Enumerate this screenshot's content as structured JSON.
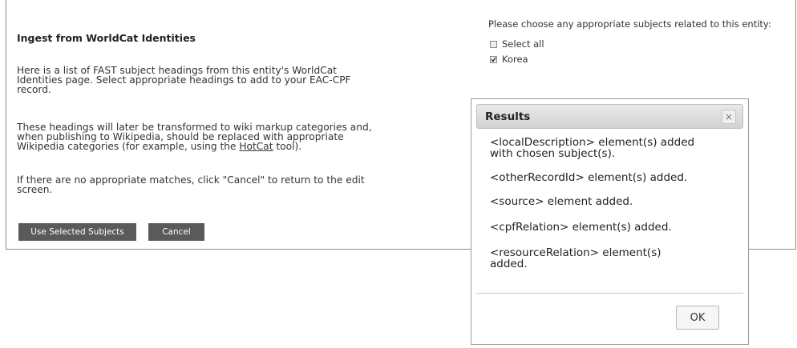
{
  "ingest": {
    "title": "Ingest from WorldCat Identities",
    "para1_line1": "Here is a list of FAST subject headings from this entity's WorldCat",
    "para1_line2": "Identities page. Select appropriate headings to add to your EAC-CPF",
    "para1_line3": "record.",
    "para2_line1": "These headings will later be transformed to wiki markup categories and,",
    "para2_line2": "when publishing to Wikipedia, should be replaced with appropriate",
    "para2_line3_pre": "Wikipedia categories (for example, using the ",
    "para2_link": "HotCat",
    "para2_line3_post": " tool).",
    "para3_line1": "If there are no appropriate matches, click \"Cancel\" to return to the edit",
    "para3_line2": "screen.",
    "use_button": "Use Selected Subjects",
    "cancel_button": "Cancel"
  },
  "subjects": {
    "prompt": "Please choose any appropriate subjects related to this entity:",
    "select_all_label": "Select all",
    "select_all_checked": false,
    "items": [
      {
        "label": "Korea",
        "checked": true
      }
    ]
  },
  "dialog": {
    "title": "Results",
    "close_glyph": "×",
    "messages": [
      {
        "line1": "<localDescription> element(s) added",
        "line2": "with chosen subject(s)."
      },
      {
        "line1": "<otherRecordId> element(s) added.",
        "line2": ""
      },
      {
        "line1": "<source> element added.",
        "line2": ""
      },
      {
        "line1": "<cpfRelation> element(s) added.",
        "line2": ""
      },
      {
        "line1": "<resourceRelation> element(s)",
        "line2": "added."
      }
    ],
    "ok_label": "OK"
  },
  "colors": {
    "button_bg": "#5a5a5a",
    "dialog_header": "#d9d9d9"
  }
}
